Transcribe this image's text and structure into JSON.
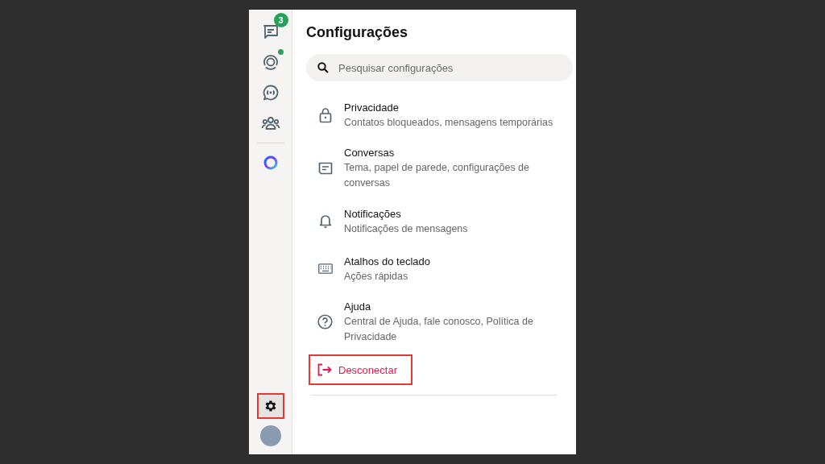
{
  "sidebar": {
    "items": [
      {
        "kind": "chats",
        "badge": "3",
        "unread_dot": false,
        "selected": false
      },
      {
        "kind": "status",
        "unread_dot": true,
        "selected": false
      },
      {
        "kind": "channels",
        "unread_dot": false,
        "selected": false
      },
      {
        "kind": "communities",
        "unread_dot": false,
        "selected": false
      },
      {
        "kind": "ai",
        "unread_dot": false,
        "selected": false
      }
    ],
    "settings": {
      "selected": true,
      "highlighted": true
    }
  },
  "panel": {
    "title": "Configurações",
    "search": {
      "placeholder": "Pesquisar configurações"
    },
    "items": [
      {
        "kind": "lock",
        "title": "Privacidade",
        "subtitle": "Contatos bloqueados, mensagens temporárias"
      },
      {
        "kind": "chat",
        "title": "Conversas",
        "subtitle": "Tema, papel de parede, configurações de conversas"
      },
      {
        "kind": "bell",
        "title": "Notificações",
        "subtitle": "Notificações de mensagens"
      },
      {
        "kind": "keyboard",
        "title": "Atalhos do teclado",
        "subtitle": "Ações rápidas"
      },
      {
        "kind": "help",
        "title": "Ajuda",
        "subtitle": "Central de Ajuda, fale conosco, Política de Privacidade"
      }
    ],
    "logout": {
      "label": "Desconectar",
      "highlighted": true
    }
  }
}
